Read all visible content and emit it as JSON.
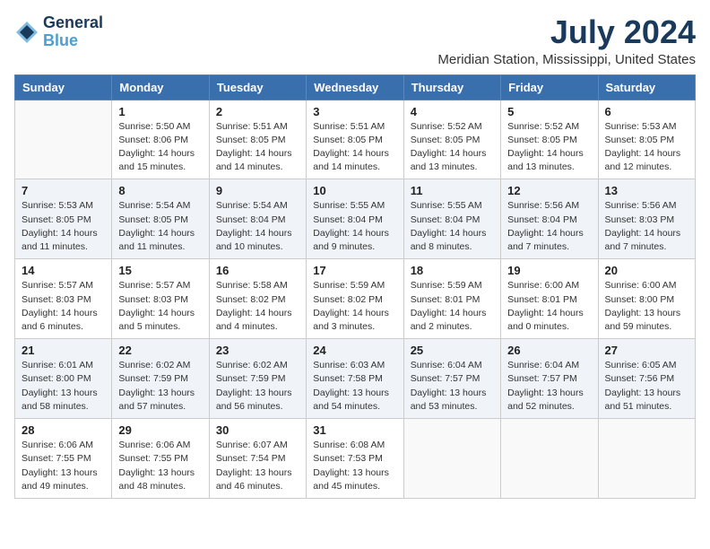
{
  "logo": {
    "line1": "General",
    "line2": "Blue"
  },
  "title": "July 2024",
  "location": "Meridian Station, Mississippi, United States",
  "weekdays": [
    "Sunday",
    "Monday",
    "Tuesday",
    "Wednesday",
    "Thursday",
    "Friday",
    "Saturday"
  ],
  "weeks": [
    [
      {
        "day": "",
        "sunrise": "",
        "sunset": "",
        "daylight": ""
      },
      {
        "day": "1",
        "sunrise": "Sunrise: 5:50 AM",
        "sunset": "Sunset: 8:06 PM",
        "daylight": "Daylight: 14 hours and 15 minutes."
      },
      {
        "day": "2",
        "sunrise": "Sunrise: 5:51 AM",
        "sunset": "Sunset: 8:05 PM",
        "daylight": "Daylight: 14 hours and 14 minutes."
      },
      {
        "day": "3",
        "sunrise": "Sunrise: 5:51 AM",
        "sunset": "Sunset: 8:05 PM",
        "daylight": "Daylight: 14 hours and 14 minutes."
      },
      {
        "day": "4",
        "sunrise": "Sunrise: 5:52 AM",
        "sunset": "Sunset: 8:05 PM",
        "daylight": "Daylight: 14 hours and 13 minutes."
      },
      {
        "day": "5",
        "sunrise": "Sunrise: 5:52 AM",
        "sunset": "Sunset: 8:05 PM",
        "daylight": "Daylight: 14 hours and 13 minutes."
      },
      {
        "day": "6",
        "sunrise": "Sunrise: 5:53 AM",
        "sunset": "Sunset: 8:05 PM",
        "daylight": "Daylight: 14 hours and 12 minutes."
      }
    ],
    [
      {
        "day": "7",
        "sunrise": "Sunrise: 5:53 AM",
        "sunset": "Sunset: 8:05 PM",
        "daylight": "Daylight: 14 hours and 11 minutes."
      },
      {
        "day": "8",
        "sunrise": "Sunrise: 5:54 AM",
        "sunset": "Sunset: 8:05 PM",
        "daylight": "Daylight: 14 hours and 11 minutes."
      },
      {
        "day": "9",
        "sunrise": "Sunrise: 5:54 AM",
        "sunset": "Sunset: 8:04 PM",
        "daylight": "Daylight: 14 hours and 10 minutes."
      },
      {
        "day": "10",
        "sunrise": "Sunrise: 5:55 AM",
        "sunset": "Sunset: 8:04 PM",
        "daylight": "Daylight: 14 hours and 9 minutes."
      },
      {
        "day": "11",
        "sunrise": "Sunrise: 5:55 AM",
        "sunset": "Sunset: 8:04 PM",
        "daylight": "Daylight: 14 hours and 8 minutes."
      },
      {
        "day": "12",
        "sunrise": "Sunrise: 5:56 AM",
        "sunset": "Sunset: 8:04 PM",
        "daylight": "Daylight: 14 hours and 7 minutes."
      },
      {
        "day": "13",
        "sunrise": "Sunrise: 5:56 AM",
        "sunset": "Sunset: 8:03 PM",
        "daylight": "Daylight: 14 hours and 7 minutes."
      }
    ],
    [
      {
        "day": "14",
        "sunrise": "Sunrise: 5:57 AM",
        "sunset": "Sunset: 8:03 PM",
        "daylight": "Daylight: 14 hours and 6 minutes."
      },
      {
        "day": "15",
        "sunrise": "Sunrise: 5:57 AM",
        "sunset": "Sunset: 8:03 PM",
        "daylight": "Daylight: 14 hours and 5 minutes."
      },
      {
        "day": "16",
        "sunrise": "Sunrise: 5:58 AM",
        "sunset": "Sunset: 8:02 PM",
        "daylight": "Daylight: 14 hours and 4 minutes."
      },
      {
        "day": "17",
        "sunrise": "Sunrise: 5:59 AM",
        "sunset": "Sunset: 8:02 PM",
        "daylight": "Daylight: 14 hours and 3 minutes."
      },
      {
        "day": "18",
        "sunrise": "Sunrise: 5:59 AM",
        "sunset": "Sunset: 8:01 PM",
        "daylight": "Daylight: 14 hours and 2 minutes."
      },
      {
        "day": "19",
        "sunrise": "Sunrise: 6:00 AM",
        "sunset": "Sunset: 8:01 PM",
        "daylight": "Daylight: 14 hours and 0 minutes."
      },
      {
        "day": "20",
        "sunrise": "Sunrise: 6:00 AM",
        "sunset": "Sunset: 8:00 PM",
        "daylight": "Daylight: 13 hours and 59 minutes."
      }
    ],
    [
      {
        "day": "21",
        "sunrise": "Sunrise: 6:01 AM",
        "sunset": "Sunset: 8:00 PM",
        "daylight": "Daylight: 13 hours and 58 minutes."
      },
      {
        "day": "22",
        "sunrise": "Sunrise: 6:02 AM",
        "sunset": "Sunset: 7:59 PM",
        "daylight": "Daylight: 13 hours and 57 minutes."
      },
      {
        "day": "23",
        "sunrise": "Sunrise: 6:02 AM",
        "sunset": "Sunset: 7:59 PM",
        "daylight": "Daylight: 13 hours and 56 minutes."
      },
      {
        "day": "24",
        "sunrise": "Sunrise: 6:03 AM",
        "sunset": "Sunset: 7:58 PM",
        "daylight": "Daylight: 13 hours and 54 minutes."
      },
      {
        "day": "25",
        "sunrise": "Sunrise: 6:04 AM",
        "sunset": "Sunset: 7:57 PM",
        "daylight": "Daylight: 13 hours and 53 minutes."
      },
      {
        "day": "26",
        "sunrise": "Sunrise: 6:04 AM",
        "sunset": "Sunset: 7:57 PM",
        "daylight": "Daylight: 13 hours and 52 minutes."
      },
      {
        "day": "27",
        "sunrise": "Sunrise: 6:05 AM",
        "sunset": "Sunset: 7:56 PM",
        "daylight": "Daylight: 13 hours and 51 minutes."
      }
    ],
    [
      {
        "day": "28",
        "sunrise": "Sunrise: 6:06 AM",
        "sunset": "Sunset: 7:55 PM",
        "daylight": "Daylight: 13 hours and 49 minutes."
      },
      {
        "day": "29",
        "sunrise": "Sunrise: 6:06 AM",
        "sunset": "Sunset: 7:55 PM",
        "daylight": "Daylight: 13 hours and 48 minutes."
      },
      {
        "day": "30",
        "sunrise": "Sunrise: 6:07 AM",
        "sunset": "Sunset: 7:54 PM",
        "daylight": "Daylight: 13 hours and 46 minutes."
      },
      {
        "day": "31",
        "sunrise": "Sunrise: 6:08 AM",
        "sunset": "Sunset: 7:53 PM",
        "daylight": "Daylight: 13 hours and 45 minutes."
      },
      {
        "day": "",
        "sunrise": "",
        "sunset": "",
        "daylight": ""
      },
      {
        "day": "",
        "sunrise": "",
        "sunset": "",
        "daylight": ""
      },
      {
        "day": "",
        "sunrise": "",
        "sunset": "",
        "daylight": ""
      }
    ]
  ]
}
